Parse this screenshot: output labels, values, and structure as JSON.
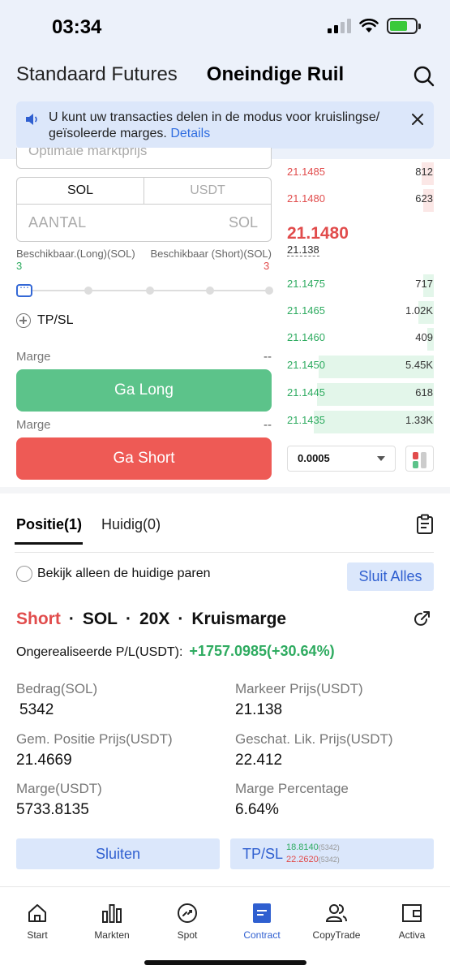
{
  "status_bar": {
    "time": "03:34"
  },
  "header": {
    "tabs": [
      {
        "label": "Standaard Futures",
        "active": false
      },
      {
        "label": "Oneindige Ruil",
        "active": true
      }
    ],
    "search_icon": "search-icon"
  },
  "notice": {
    "icon": "speaker-icon",
    "text": "U kunt uw transacties delen in de modus voor kruislingse/ geïsoleerde marges. ",
    "link": "Details"
  },
  "order_form": {
    "price_placeholder": "Optimale marktprijs",
    "unit_toggle": [
      "SOL",
      "USDT"
    ],
    "amount_placeholder": "AANTAL",
    "amount_unit": "SOL",
    "available_long_label": "Beschikbaar.(Long)(SOL)",
    "available_short_label": "Beschikbaar (Short)(SOL)",
    "available_long_value": "3",
    "available_short_value": "3",
    "tpsl_label": "TP/SL",
    "margin_label_long": "Marge",
    "margin_value_long": "--",
    "margin_label_short": "Marge",
    "margin_value_short": "--",
    "long_button": "Ga Long",
    "short_button": "Ga Short",
    "slider_level": 0
  },
  "orderbook": {
    "asks": [
      {
        "price": "21.1485",
        "qty": "812",
        "depth": 0.08
      },
      {
        "price": "21.1480",
        "qty": "623",
        "depth": 0.07
      }
    ],
    "last_price": "21.1480",
    "mark_price": "21.138",
    "bids": [
      {
        "price": "21.1475",
        "qty": "717",
        "depth": 0.07
      },
      {
        "price": "21.1465",
        "qty": "1.02K",
        "depth": 0.1
      },
      {
        "price": "21.1460",
        "qty": "409",
        "depth": 0.04
      },
      {
        "price": "21.1450",
        "qty": "5.45K",
        "depth": 0.75
      },
      {
        "price": "21.1445",
        "qty": "618",
        "depth": 0.76
      },
      {
        "price": "21.1435",
        "qty": "1.33K",
        "depth": 0.78
      }
    ],
    "precision": "0.0005"
  },
  "positions": {
    "tabs": [
      {
        "label": "Positie(1)",
        "active": true
      },
      {
        "label": "Huidig(0)",
        "active": false
      }
    ],
    "filter_label": "Bekijk alleen de huidige paren",
    "close_all_button": "Sluit Alles",
    "position": {
      "side": "Short",
      "sep1": "·",
      "symbol": "SOL",
      "sep2": "·",
      "leverage": "20X",
      "sep3": "·",
      "margin_mode": "Kruismarge",
      "pnl_label": "Ongerealiseerde P/L(USDT):",
      "pnl_value": "+1757.0985(+30.64%)",
      "fields": {
        "amount_label": "Bedrag(SOL)",
        "amount_value": "5342",
        "mark_label": "Markeer Prijs(USDT)",
        "mark_value": "21.138",
        "entry_label": "Gem. Positie Prijs(USDT)",
        "entry_value": "21.4669",
        "liq_label": "Geschat. Lik. Prijs(USDT)",
        "liq_value": "22.412",
        "margin_label": "Marge(USDT)",
        "margin_value": "5733.8135",
        "margin_pct_label": "Marge Percentage",
        "margin_pct_value": "6.64%"
      },
      "close_button": "Sluiten",
      "tpsl_button": "TP/SL",
      "tp_value": "18.8140",
      "tp_sub": "(5342)",
      "sl_value": "22.2620",
      "sl_sub": "(5342)"
    }
  },
  "bottom_nav": [
    {
      "label": "Start",
      "icon": "home-icon",
      "active": false
    },
    {
      "label": "Markten",
      "icon": "bar-chart-icon",
      "active": false
    },
    {
      "label": "Spot",
      "icon": "spot-icon",
      "active": false
    },
    {
      "label": "Contract",
      "icon": "contract-icon",
      "active": true
    },
    {
      "label": "CopyTrade",
      "icon": "copytrade-icon",
      "active": false
    },
    {
      "label": "Activa",
      "icon": "wallet-icon",
      "active": false
    }
  ],
  "colors": {
    "accent": "#2f5fd0",
    "long": "#5cc38a",
    "short": "#ee5a55",
    "price_up": "#2eab60",
    "price_down": "#e14c4c"
  }
}
